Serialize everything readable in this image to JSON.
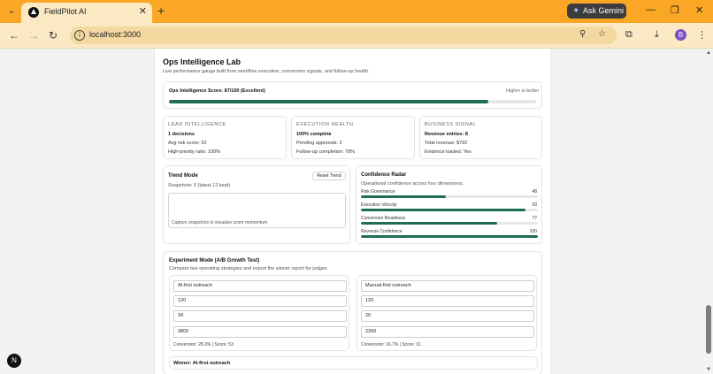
{
  "browser": {
    "tab_title": "FieldPilot AI",
    "url": "localhost:3000",
    "gemini_label": "Ask Gemini",
    "profile_initial": "B",
    "icons": [
      "chevron-down-icon",
      "close-icon",
      "plus-icon",
      "back-icon",
      "forward-icon",
      "reload-icon",
      "info-icon",
      "zoom-icon",
      "star-icon",
      "extensions-icon",
      "download-icon",
      "menu-icon"
    ]
  },
  "page": {
    "title": "Ops Intelligence Lab",
    "subtitle": "Live performance gauge built from workflow execution, conversion signals, and follow-up health."
  },
  "score": {
    "label": "Ops Intelligence Score: 87/100 (Excellent)",
    "hint": "Higher is better",
    "value": 87
  },
  "lead": {
    "caption": "LEAD INTELLIGENCE",
    "headline": "1 decisions",
    "line1": "Avg risk score: 62",
    "line2": "High-priority ratio: 100%"
  },
  "execution": {
    "caption": "EXECUTION HEALTH",
    "headline": "100% complete",
    "line1": "Pending approvals: 2",
    "line2": "Follow-up completion: 78%"
  },
  "business": {
    "caption": "BUSINESS SIGNAL",
    "headline": "Revenue entries: 8",
    "line1": "Total revenue: $792",
    "line2": "Evidence loaded: Yes"
  },
  "trend": {
    "title": "Trend Mode",
    "reset_label": "Reset Trend",
    "snapshots": "Snapshots: 0 (latest 12 kept)",
    "empty_text": "Capture snapshots to visualize score momentum."
  },
  "radar": {
    "title": "Confidence Radar",
    "subtitle": "Operational confidence across four dimensions.",
    "items": [
      {
        "label": "Risk Governance",
        "value": 48
      },
      {
        "label": "Execution Velocity",
        "value": 93
      },
      {
        "label": "Conversion Readiness",
        "value": 77
      },
      {
        "label": "Revenue Confidence",
        "value": 100
      }
    ]
  },
  "experiment": {
    "title": "Experiment Mode (A/B Growth Test)",
    "subtitle": "Compare two operating strategies and export the winner report for judges.",
    "a": {
      "name": "AI-first outreach",
      "f1": "120",
      "f2": "34",
      "f3": "3800",
      "result": "Conversion: 28.3% | Score: 53"
    },
    "b": {
      "name": "Manual-first outreach",
      "f1": "120",
      "f2": "20",
      "f3": "2200",
      "result": "Conversion: 16.7% | Score: 31"
    },
    "winner": "Winner: AI-first outreach"
  },
  "colors": {
    "accent": "#1f6e52",
    "tabstrip": "#f9a724",
    "toolbar": "#fbe9c4"
  }
}
